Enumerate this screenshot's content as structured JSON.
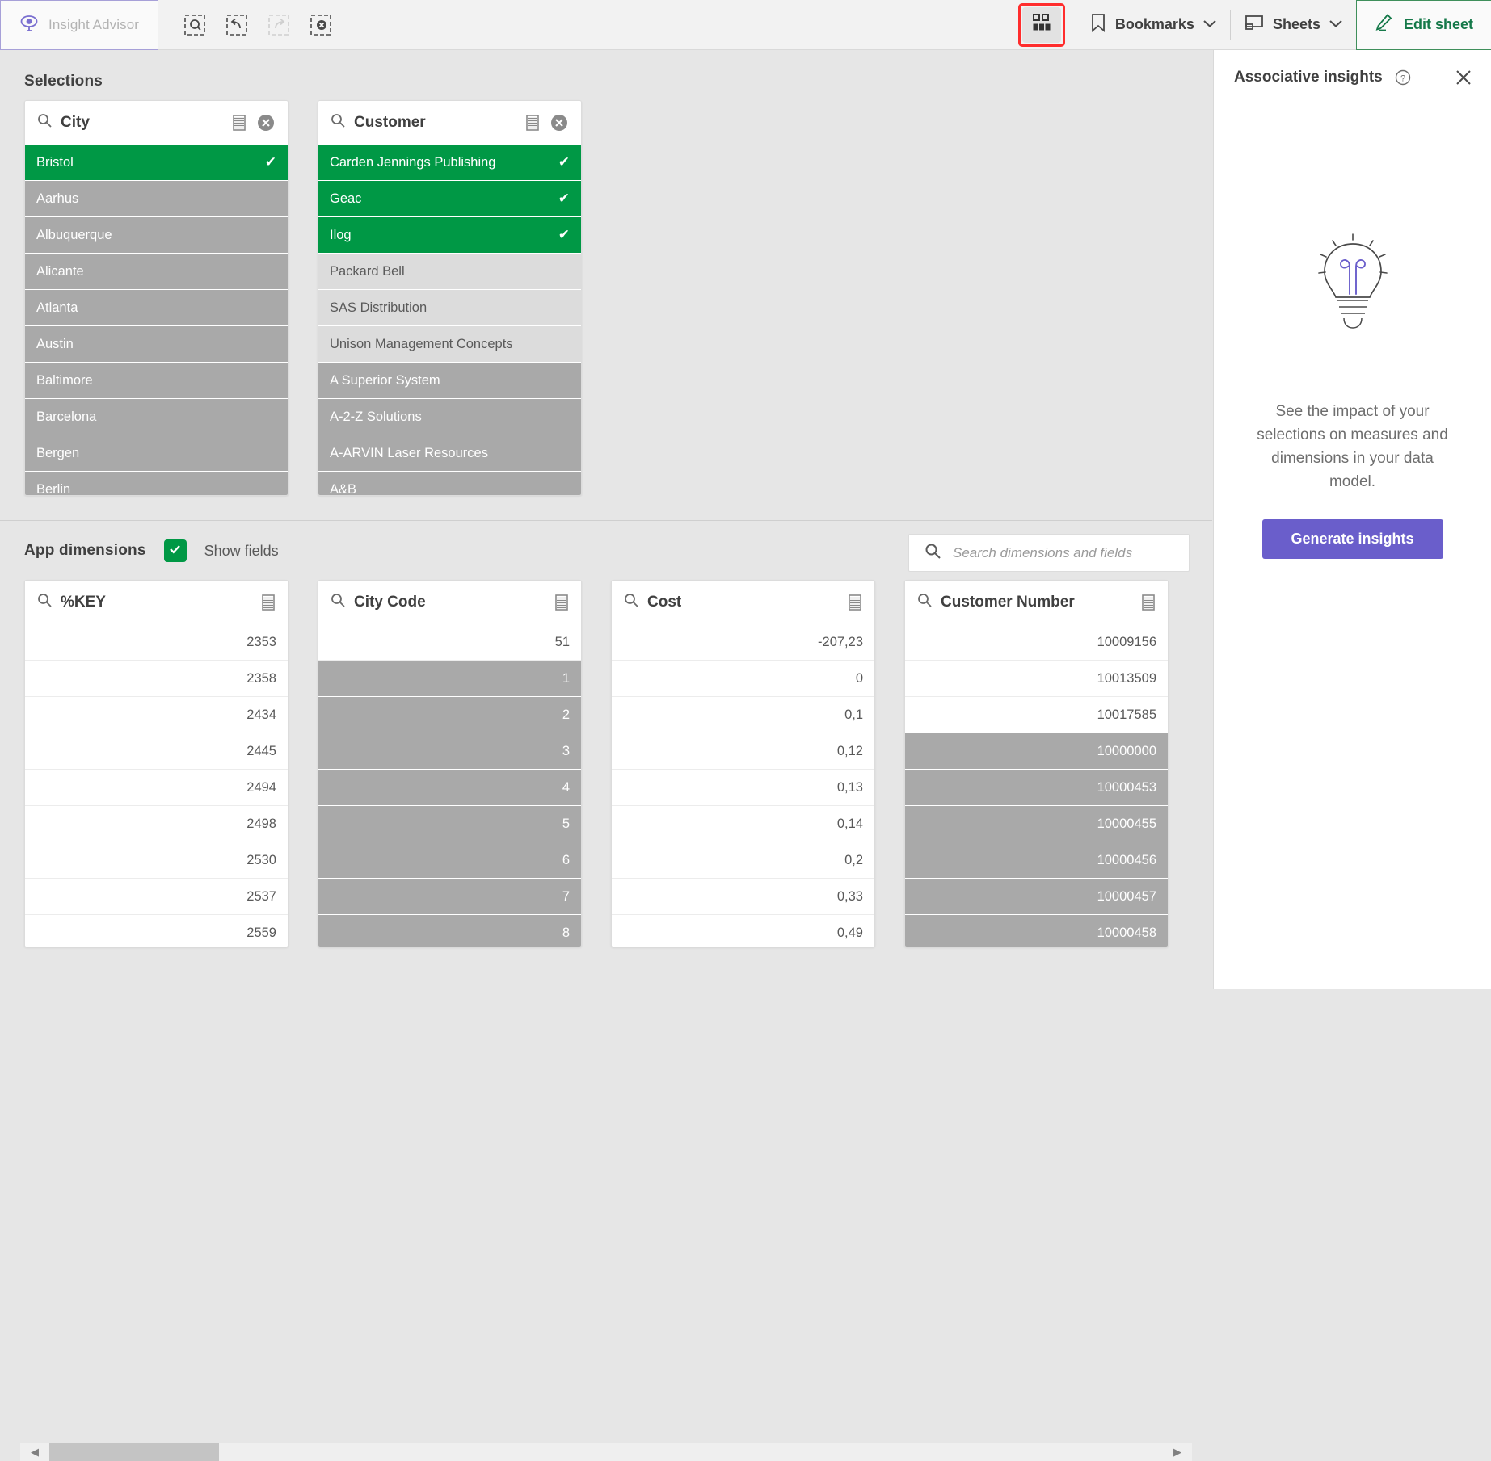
{
  "toolbar": {
    "insight_advisor_label": "Insight Advisor",
    "insight_advisor_icon": "insight-advisor-eye-icon",
    "selection_tools": [
      {
        "name": "search-selections-icon",
        "label": "Search selections",
        "disabled": false
      },
      {
        "name": "step-back-icon",
        "label": "Step back",
        "disabled": false
      },
      {
        "name": "step-forward-icon",
        "label": "Step forward",
        "disabled": true
      },
      {
        "name": "clear-all-selections-icon",
        "label": "Clear all selections",
        "disabled": false
      }
    ],
    "selections_tool_icon": "selections-tool-icon",
    "selections_tool_highlight_color": "#ff2d2d",
    "bookmarks_label": "Bookmarks",
    "bookmarks_icon": "bookmark-icon",
    "sheets_label": "Sheets",
    "sheets_icon": "sheet-icon",
    "edit_sheet_label": "Edit sheet",
    "edit_sheet_icon": "pencil-icon",
    "chevron_icon": "chevron-down-icon"
  },
  "selections": {
    "title": "Selections",
    "listboxes": [
      {
        "title": "City",
        "search_icon": "search-icon",
        "list_icon": "listbox-menu-icon",
        "clear_icon": "clear-selection-icon",
        "rows": [
          {
            "label": "Bristol",
            "state": "selected"
          },
          {
            "label": "Aarhus",
            "state": "excluded"
          },
          {
            "label": "Albuquerque",
            "state": "excluded"
          },
          {
            "label": "Alicante",
            "state": "excluded"
          },
          {
            "label": "Atlanta",
            "state": "excluded"
          },
          {
            "label": "Austin",
            "state": "excluded"
          },
          {
            "label": "Baltimore",
            "state": "excluded"
          },
          {
            "label": "Barcelona",
            "state": "excluded"
          },
          {
            "label": "Bergen",
            "state": "excluded"
          },
          {
            "label": "Berlin",
            "state": "excluded"
          }
        ]
      },
      {
        "title": "Customer",
        "search_icon": "search-icon",
        "list_icon": "listbox-menu-icon",
        "clear_icon": "clear-selection-icon",
        "rows": [
          {
            "label": "Carden Jennings Publishing",
            "state": "selected"
          },
          {
            "label": "Geac",
            "state": "selected"
          },
          {
            "label": "Ilog",
            "state": "selected"
          },
          {
            "label": "Packard Bell",
            "state": "alt"
          },
          {
            "label": "SAS Distribution",
            "state": "alt"
          },
          {
            "label": "Unison Management Concepts",
            "state": "alt"
          },
          {
            "label": "A Superior System",
            "state": "excluded"
          },
          {
            "label": "A-2-Z Solutions",
            "state": "excluded"
          },
          {
            "label": "A-ARVIN Laser Resources",
            "state": "excluded"
          },
          {
            "label": "A&B",
            "state": "excluded"
          }
        ]
      }
    ]
  },
  "app_dimensions": {
    "title": "App dimensions",
    "show_fields_label": "Show fields",
    "show_fields_checked": true,
    "check_icon": "checkmark-icon",
    "search_placeholder": "Search dimensions and fields",
    "search_value": "",
    "search_icon": "search-icon",
    "cards": [
      {
        "title": "%KEY",
        "search_icon": "search-icon",
        "list_icon": "listbox-menu-icon",
        "rows": [
          {
            "label": "2353",
            "state": "available"
          },
          {
            "label": "2358",
            "state": "available"
          },
          {
            "label": "2434",
            "state": "available"
          },
          {
            "label": "2445",
            "state": "available"
          },
          {
            "label": "2494",
            "state": "available"
          },
          {
            "label": "2498",
            "state": "available"
          },
          {
            "label": "2530",
            "state": "available"
          },
          {
            "label": "2537",
            "state": "available"
          },
          {
            "label": "2559",
            "state": "available"
          }
        ]
      },
      {
        "title": "City Code",
        "search_icon": "search-icon",
        "list_icon": "listbox-menu-icon",
        "rows": [
          {
            "label": "51",
            "state": "available"
          },
          {
            "label": "1",
            "state": "excluded"
          },
          {
            "label": "2",
            "state": "excluded"
          },
          {
            "label": "3",
            "state": "excluded"
          },
          {
            "label": "4",
            "state": "excluded"
          },
          {
            "label": "5",
            "state": "excluded"
          },
          {
            "label": "6",
            "state": "excluded"
          },
          {
            "label": "7",
            "state": "excluded"
          },
          {
            "label": "8",
            "state": "excluded"
          }
        ]
      },
      {
        "title": "Cost",
        "search_icon": "search-icon",
        "list_icon": "listbox-menu-icon",
        "rows": [
          {
            "label": "-207,23",
            "state": "available"
          },
          {
            "label": "0",
            "state": "available"
          },
          {
            "label": "0,1",
            "state": "available"
          },
          {
            "label": "0,12",
            "state": "available"
          },
          {
            "label": "0,13",
            "state": "available"
          },
          {
            "label": "0,14",
            "state": "available"
          },
          {
            "label": "0,2",
            "state": "available"
          },
          {
            "label": "0,33",
            "state": "available"
          },
          {
            "label": "0,49",
            "state": "available"
          }
        ]
      },
      {
        "title": "Customer Number",
        "search_icon": "search-icon",
        "list_icon": "listbox-menu-icon",
        "rows": [
          {
            "label": "10009156",
            "state": "available"
          },
          {
            "label": "10013509",
            "state": "available"
          },
          {
            "label": "10017585",
            "state": "available"
          },
          {
            "label": "10000000",
            "state": "excluded"
          },
          {
            "label": "10000453",
            "state": "excluded"
          },
          {
            "label": "10000455",
            "state": "excluded"
          },
          {
            "label": "10000456",
            "state": "excluded"
          },
          {
            "label": "10000457",
            "state": "excluded"
          },
          {
            "label": "10000458",
            "state": "excluded"
          }
        ]
      }
    ],
    "scroll_left_icon": "scroll-left-arrow-icon",
    "scroll_right_icon": "scroll-right-arrow-icon"
  },
  "associative_insights": {
    "title": "Associative insights",
    "help_icon": "help-circle-icon",
    "close_icon": "close-icon",
    "bulb_icon": "lightbulb-icon",
    "description": "See the impact of your selections on measures and dimensions in your data model.",
    "generate_label": "Generate insights",
    "accent_color": "#6a5ecb"
  },
  "colors": {
    "selected_green": "#009845",
    "excluded_gray": "#a9a9a9",
    "alternative_gray": "#dcdcdc",
    "available_white": "#ffffff",
    "brand_purple": "#6a5ecb",
    "edit_green": "#16794a"
  }
}
